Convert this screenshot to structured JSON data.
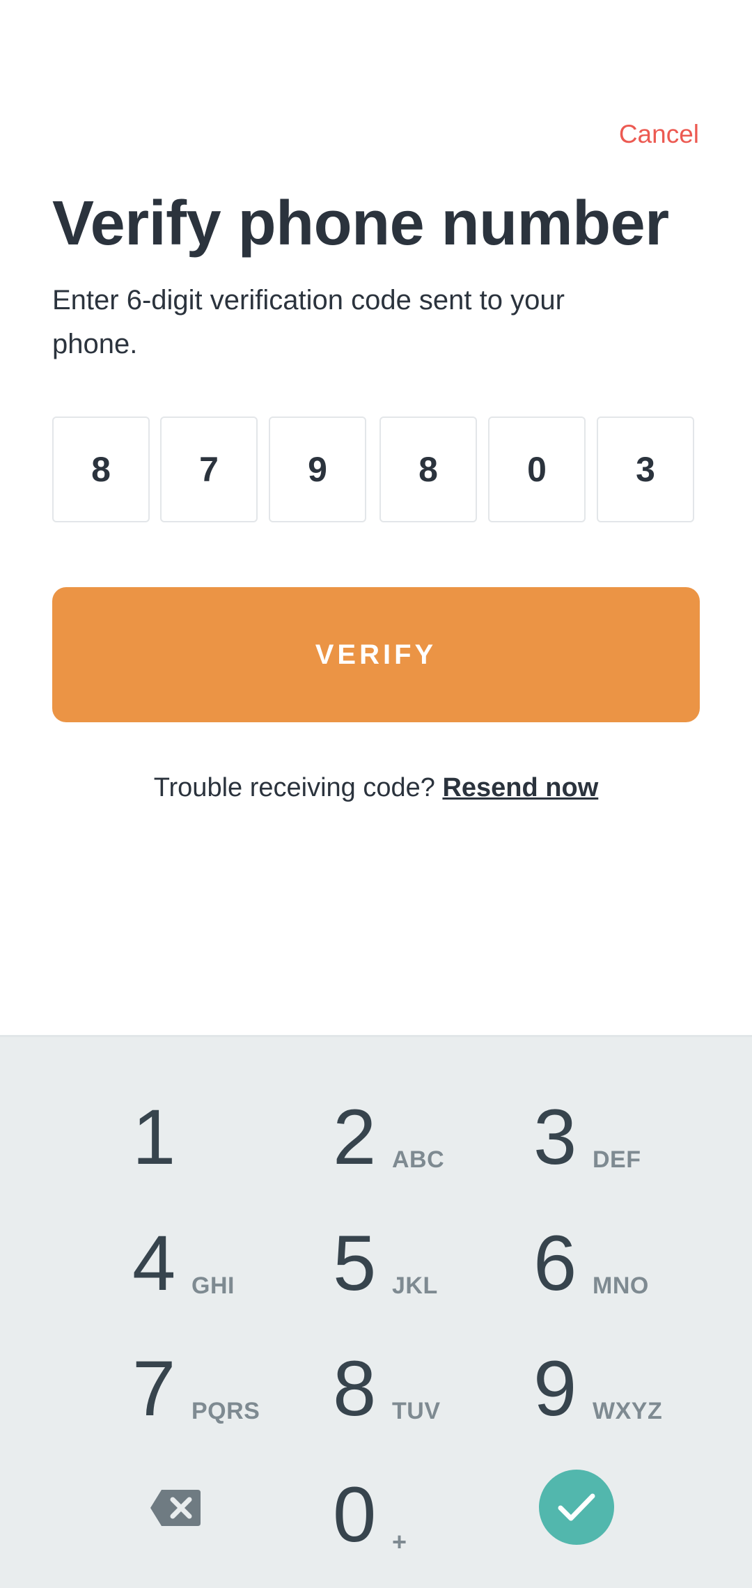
{
  "header": {
    "cancel_label": "Cancel",
    "title": "Verify phone number",
    "subtitle": "Enter 6-digit verification code sent to your phone."
  },
  "code": {
    "digits": [
      "8",
      "7",
      "9",
      "8",
      "0",
      "3"
    ]
  },
  "actions": {
    "verify_label": "VERIFY",
    "trouble_text": "Trouble receiving code?",
    "resend_label": "Resend now"
  },
  "keypad": {
    "keys": [
      {
        "digit": "1",
        "letters": ""
      },
      {
        "digit": "2",
        "letters": "ABC"
      },
      {
        "digit": "3",
        "letters": "DEF"
      },
      {
        "digit": "4",
        "letters": "GHI"
      },
      {
        "digit": "5",
        "letters": "JKL"
      },
      {
        "digit": "6",
        "letters": "MNO"
      },
      {
        "digit": "7",
        "letters": "PQRS"
      },
      {
        "digit": "8",
        "letters": "TUV"
      },
      {
        "digit": "9",
        "letters": "WXYZ"
      },
      {
        "digit": "0",
        "letters": "+"
      }
    ],
    "backspace_icon": "backspace-icon",
    "confirm_icon": "checkmark-icon"
  },
  "colors": {
    "accent": "#eb9445",
    "cancel": "#ec5a52",
    "confirm": "#52b7ad",
    "keypad_bg": "#e9edee",
    "text": "#2b333d"
  }
}
